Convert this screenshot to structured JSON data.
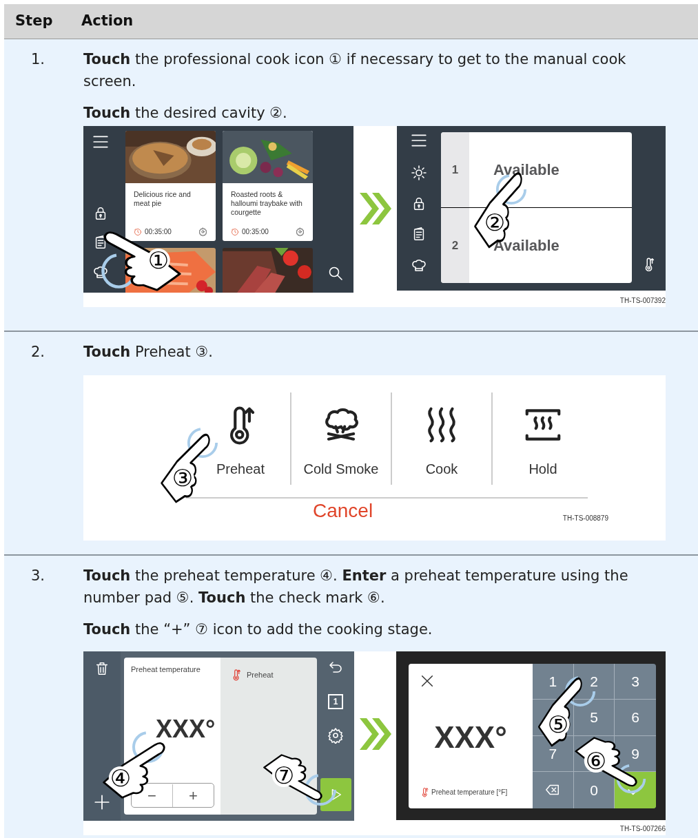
{
  "table": {
    "columns": [
      "Step",
      "Action"
    ]
  },
  "steps": [
    {
      "number": "1.",
      "paragraphs": [
        "**Touch** the professional cook icon ① if necessary to get to the manual cook screen.",
        "**Touch** the desired cavity ②."
      ],
      "figure": {
        "kind": "two_screens",
        "caption": "TH-TS-007392",
        "screens": [
          {
            "kind": "recipes",
            "cards": [
              {
                "kind": "recipe",
                "title": "Delicious rice and meat pie",
                "time": "00:35:00"
              },
              {
                "kind": "recipe",
                "title": "Roasted roots & halloumi traybake with courgette",
                "time": "00:35:00"
              },
              {
                "kind": "picture"
              },
              {
                "kind": "picture"
              }
            ],
            "callouts": [
              {
                "marker": "①"
              }
            ]
          },
          {
            "kind": "cavities",
            "cavities": [
              {
                "number": "1",
                "status": "Available"
              },
              {
                "number": "2",
                "status": "Available"
              }
            ],
            "callouts": [
              {
                "marker": "②"
              }
            ]
          }
        ]
      }
    },
    {
      "number": "2.",
      "paragraphs": [
        "**Touch** Preheat ③."
      ],
      "figure": {
        "kind": "modes",
        "caption": "TH-TS-008879",
        "modes": [
          {
            "label": "Preheat"
          },
          {
            "label": "Cold Smoke"
          },
          {
            "label": "Cook"
          },
          {
            "label": "Hold"
          }
        ],
        "cancel": "Cancel",
        "callouts": [
          {
            "marker": "③"
          }
        ]
      }
    },
    {
      "number": "3.",
      "paragraphs": [
        "**Touch** the preheat temperature ④. **Enter** a preheat temperature using the number pad ⑤. **Touch** the check mark ⑥.",
        "**Touch** the “+” ⑦ icon to add the cooking stage."
      ],
      "figure": {
        "kind": "two_screens",
        "caption": "TH-TS-007266",
        "screens": [
          {
            "kind": "stage_editor",
            "label": "Preheat temperature",
            "value": "XXX°",
            "minus": "−",
            "plus": "+",
            "stage": "Preheat",
            "cavity_badge": "1",
            "callouts": [
              {
                "marker": "④"
              },
              {
                "marker": "⑦"
              }
            ]
          },
          {
            "kind": "keypad",
            "value": "XXX°",
            "label": "Preheat temperature [°F]",
            "keys": [
              {
                "kind": "digit",
                "label": "1"
              },
              {
                "kind": "digit",
                "label": "2"
              },
              {
                "kind": "digit",
                "label": "3"
              },
              {
                "kind": "blank"
              },
              {
                "kind": "digit",
                "label": "5"
              },
              {
                "kind": "digit",
                "label": "6"
              },
              {
                "kind": "digit",
                "label": "7"
              },
              {
                "kind": "blank"
              },
              {
                "kind": "digit",
                "label": "9"
              },
              {
                "kind": "backspace"
              },
              {
                "kind": "digit",
                "label": "0"
              },
              {
                "kind": "confirm"
              }
            ],
            "callouts": [
              {
                "marker": "⑤"
              },
              {
                "marker": "⑥"
              }
            ]
          }
        ]
      }
    }
  ]
}
